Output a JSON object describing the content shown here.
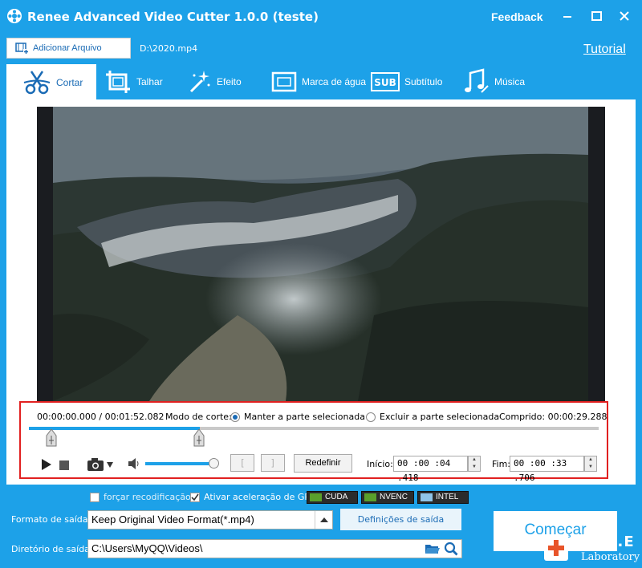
{
  "window": {
    "title": "Renee Advanced Video Cutter 1.0.0 (teste)",
    "feedback": "Feedback"
  },
  "toolbar": {
    "add_file": "Adicionar Arquivo",
    "file_path": "D:\\2020.mp4",
    "tutorial": "Tutorial"
  },
  "tabs": [
    {
      "label": "Cortar",
      "icon": "scissors-icon"
    },
    {
      "label": "Talhar",
      "icon": "crop-icon"
    },
    {
      "label": "Efeito",
      "icon": "magic-wand-icon"
    },
    {
      "label": "Marca de água",
      "icon": "watermark-icon"
    },
    {
      "label": "Subtítulo",
      "icon": "subtitle-icon"
    },
    {
      "label": "Música",
      "icon": "music-icon"
    }
  ],
  "controls": {
    "time_current": "00:00:00.000",
    "time_total": "/ 00:01:52.082",
    "cut_mode_label": "Modo de corte:",
    "keep_label": "Manter a parte selecionada",
    "exclude_label": "Excluir a parte selecionada",
    "length_label": "Comprido:",
    "length_value": "00:00:29.288",
    "reset": "Redefinir",
    "start_label": "Início:",
    "start_value": "00 :00 :04 .418",
    "end_label": "Fim:",
    "end_value": "00 :00 :33 .706",
    "bracket_left": "[",
    "bracket_right": "]",
    "volume_level": 0.9,
    "progress_fraction": 0.3,
    "selected_mode": "keep"
  },
  "options": {
    "force_reencode": "forçar recodificação",
    "gpu_accel": "Ativar aceleração de GPU",
    "gpu_accel_checked": true,
    "gpu_badges": [
      "CUDA",
      "NVENC",
      "INTEL"
    ]
  },
  "output": {
    "format_label": "Formato de saída:",
    "format_value": "Keep Original Video Format(*.mp4)",
    "settings_button": "Definições de saída",
    "dir_label": "Diretório de saída:",
    "dir_value": "C:\\Users\\MyQQ\\Videos\\",
    "start_button": "Começar"
  },
  "watermark": {
    "line1": "RENE.E",
    "line2": "Laboratory"
  },
  "colors": {
    "accent": "#1da1e8",
    "highlight_border": "#e12020",
    "link": "#1a6bb5"
  }
}
